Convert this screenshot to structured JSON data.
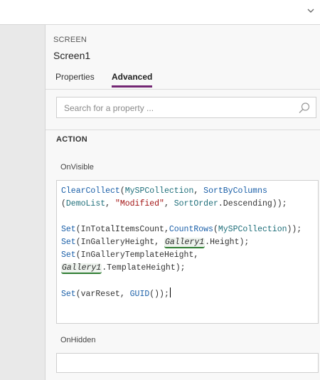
{
  "topbar": {
    "dropdown_icon": "chevron-down-icon"
  },
  "panel": {
    "section_label": "SCREEN",
    "screen_name": "Screen1",
    "tabs": [
      {
        "label": "Properties",
        "active": false
      },
      {
        "label": "Advanced",
        "active": true
      }
    ],
    "accent_color": "#742774"
  },
  "search": {
    "placeholder": "Search for a property ...",
    "value": "",
    "icon": "search-icon"
  },
  "action": {
    "heading": "ACTION",
    "properties": [
      {
        "name": "OnVisible",
        "lines": [
          [
            {
              "t": "fn",
              "v": "ClearCollect"
            },
            {
              "t": "plain",
              "v": "("
            },
            {
              "t": "var",
              "v": "MySPCollection"
            },
            {
              "t": "plain",
              "v": ", "
            },
            {
              "t": "fn",
              "v": "SortByColumns"
            }
          ],
          [
            {
              "t": "plain",
              "v": "("
            },
            {
              "t": "var",
              "v": "DemoList"
            },
            {
              "t": "plain",
              "v": ", "
            },
            {
              "t": "str",
              "v": "\"Modified\""
            },
            {
              "t": "plain",
              "v": ", "
            },
            {
              "t": "var",
              "v": "SortOrder"
            },
            {
              "t": "plain",
              "v": ".Descending));"
            }
          ],
          [],
          [
            {
              "t": "fn",
              "v": "Set"
            },
            {
              "t": "plain",
              "v": "(InTotalItemsCount,"
            },
            {
              "t": "fn",
              "v": "CountRows"
            },
            {
              "t": "plain",
              "v": "("
            },
            {
              "t": "var",
              "v": "MySPCollection"
            },
            {
              "t": "plain",
              "v": "));"
            }
          ],
          [
            {
              "t": "fn",
              "v": "Set"
            },
            {
              "t": "plain",
              "v": "(InGalleryHeight, "
            },
            {
              "t": "ctrl",
              "v": "Gallery1"
            },
            {
              "t": "plain",
              "v": ".Height);"
            }
          ],
          [
            {
              "t": "fn",
              "v": "Set"
            },
            {
              "t": "plain",
              "v": "(InGalleryTemplateHeight,"
            }
          ],
          [
            {
              "t": "ctrl",
              "v": "Gallery1"
            },
            {
              "t": "plain",
              "v": ".TemplateHeight);"
            }
          ],
          [],
          [
            {
              "t": "fn",
              "v": "Set"
            },
            {
              "t": "plain",
              "v": "(varReset, "
            },
            {
              "t": "fn",
              "v": "GUID"
            },
            {
              "t": "plain",
              "v": "());"
            },
            {
              "t": "caret",
              "v": ""
            }
          ]
        ]
      },
      {
        "name": "OnHidden",
        "lines": []
      }
    ]
  }
}
